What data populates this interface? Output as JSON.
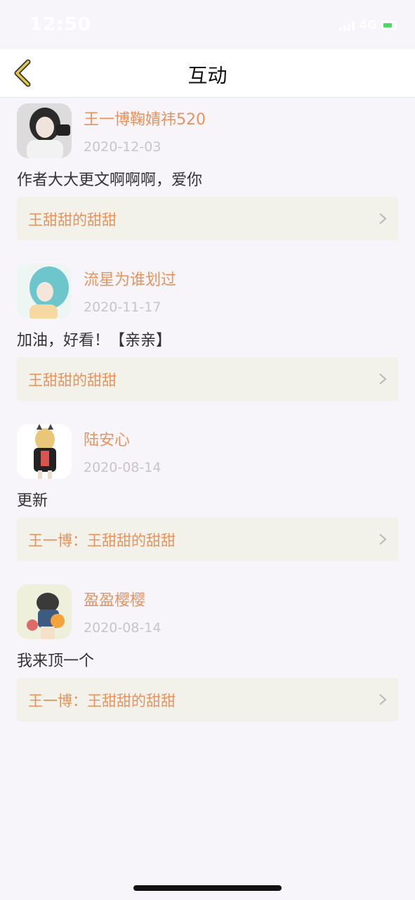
{
  "status_bar": {
    "time": "12:50",
    "network": "4G",
    "battery_color": "#4cd964"
  },
  "nav": {
    "title": "互动",
    "back_icon": "chevron-left-icon",
    "accent": "#e5c84a"
  },
  "colors": {
    "username": "#e8935e",
    "date": "#c8c4c8",
    "ref_bg": "#f2f2ea"
  },
  "comments": [
    {
      "username": "王一博鞠婧祎520",
      "date": "2020-12-03",
      "text": "作者大大更文啊啊啊，爱你",
      "ref": "王甜甜的甜甜"
    },
    {
      "username": "流星为谁划过",
      "date": "2020-11-17",
      "text": "加油，好看！【亲亲】",
      "ref": "王甜甜的甜甜"
    },
    {
      "username": "陆安心",
      "date": "2020-08-14",
      "text": "更新",
      "ref": "王一博：王甜甜的甜甜"
    },
    {
      "username": "盈盈樱樱",
      "date": "2020-08-14",
      "text": "我来顶一个",
      "ref": "王一博：王甜甜的甜甜"
    }
  ]
}
